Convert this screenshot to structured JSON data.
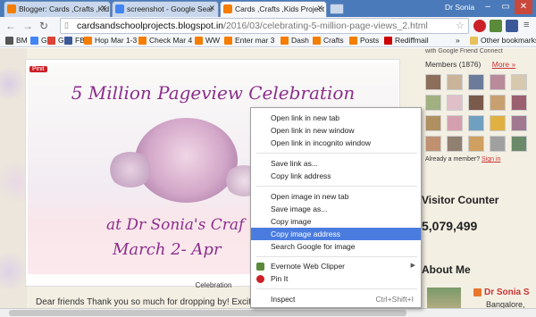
{
  "tabs": [
    {
      "label": "Blogger: Cards ,Crafts ,Kid",
      "color": "#f57d00"
    },
    {
      "label": "screenshot - Google Sear",
      "color": "#4285f4"
    },
    {
      "label": "Cards ,Crafts ,Kids Project",
      "color": "#f57d00"
    }
  ],
  "user": "Dr Sonia",
  "window_controls": {
    "minimize": "–",
    "maximize": "▭",
    "close": "✕"
  },
  "address": {
    "host": "cardsandschoolprojects.blogspot.in",
    "path": "/2016/03/celebrating-5-million-page-views_2.html"
  },
  "bookmarks": [
    {
      "label": "BM",
      "icon": "star-icon",
      "color": "#555"
    },
    {
      "label": "G",
      "icon": "google-icon",
      "color": "#4285f4"
    },
    {
      "label": "G",
      "icon": "google-icon",
      "color": "#db4437"
    },
    {
      "label": "FB",
      "icon": "facebook-icon",
      "color": "#3b5998"
    },
    {
      "label": "Hop Mar 1-3",
      "icon": "blogger-icon",
      "color": "#f57d00"
    },
    {
      "label": "Check Mar 4",
      "icon": "blogger-icon",
      "color": "#f57d00"
    },
    {
      "label": "WW",
      "icon": "blogger-icon",
      "color": "#f57d00"
    },
    {
      "label": "Enter mar 3",
      "icon": "blogger-icon",
      "color": "#f57d00"
    },
    {
      "label": "Dash",
      "icon": "blogger-icon",
      "color": "#f57d00"
    },
    {
      "label": "Crafts",
      "icon": "blogger-icon",
      "color": "#f57d00"
    },
    {
      "label": "Posts",
      "icon": "blogger-icon",
      "color": "#f57d00"
    },
    {
      "label": "Rediffmail",
      "icon": "rediff-icon",
      "color": "#c00"
    }
  ],
  "bookmarks_overflow": "»",
  "other_bookmarks": "Other bookmarks",
  "post": {
    "pin_label": "Pinit",
    "banner_title": "5 Million Pageview Celebration",
    "banner_line2": "at Dr Sonia's Craf",
    "banner_line3": "March 2- Apr",
    "caption": "Celebration",
    "body_text": "Dear friends Thank you so much for dropping by! Excited to share..."
  },
  "sidebar": {
    "members_label": "Members (1876)",
    "more_label": "More »",
    "connect_text": "with Google Friend Connect",
    "already_text": "Already a member?",
    "signin_label": "Sign in",
    "visitor_title": "Visitor Counter",
    "visitor_count": "5,079,499",
    "about_title": "About Me",
    "profile_name": "Dr Sonia S",
    "profile_city": "Bangalore, Ind"
  },
  "context_menu": {
    "items": [
      {
        "label": "Open link in new tab"
      },
      {
        "label": "Open link in new window"
      },
      {
        "label": "Open link in incognito window"
      },
      {
        "label": "Save link as..."
      },
      {
        "label": "Copy link address"
      },
      {
        "label": "Open image in new tab"
      },
      {
        "label": "Save image as..."
      },
      {
        "label": "Copy image"
      },
      {
        "label": "Copy image address",
        "highlighted": true
      },
      {
        "label": "Search Google for image"
      },
      {
        "label": "Evernote Web Clipper",
        "submenu": true
      },
      {
        "label": "Pin It"
      },
      {
        "label": "Inspect",
        "shortcut": "Ctrl+Shift+I"
      }
    ]
  }
}
